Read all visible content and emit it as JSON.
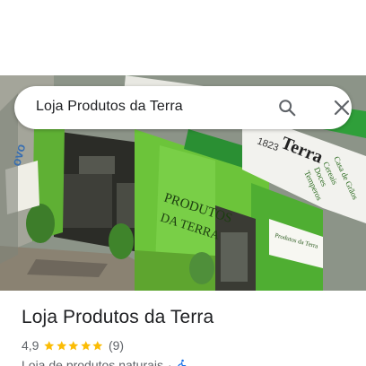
{
  "search": {
    "query": "Loja Produtos da Terra",
    "search_icon": "search-icon",
    "close_icon": "close-icon"
  },
  "photo": {
    "sign_main": "PRODUTOS",
    "sign_sub": "DA TERRA",
    "banner_year": "1823",
    "banner_text": "Terra",
    "sign_right_lines": [
      "Casa de Grãos",
      "Cereais",
      "Doces",
      "Temperos"
    ],
    "door_sign_title": "Produtos da Terra",
    "left_sign": "ovo"
  },
  "place": {
    "title": "Loja Produtos da Terra",
    "rating": "4,9",
    "stars": 5,
    "review_count": "(9)",
    "category": "Loja de produtos naturais",
    "separator": "·",
    "accessibility_icon": "wheelchair-icon"
  },
  "colors": {
    "star": "#fbbc04",
    "accessibility": "#1a73e8",
    "wall_green": "#6cc43a",
    "awning_green": "#2f9f3a"
  }
}
